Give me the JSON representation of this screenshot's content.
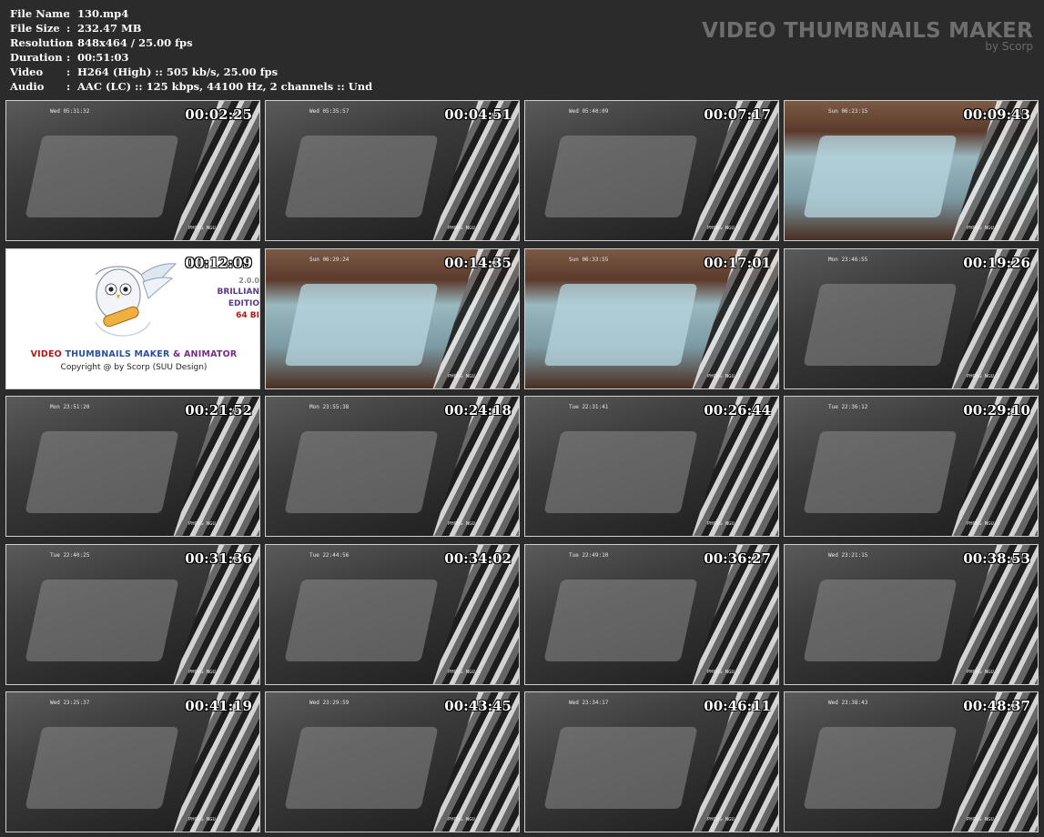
{
  "info": {
    "rows": [
      {
        "label": "File Name",
        "sep": ":",
        "value": "130.mp4"
      },
      {
        "label": "File Size",
        "sep": ":",
        "value": "232.47 MB"
      },
      {
        "label": "Resolution",
        "sep": ":",
        "value": "848x464 / 25.00 fps"
      },
      {
        "label": "Duration",
        "sep": ":",
        "value": "00:51:03"
      },
      {
        "label": "Video",
        "sep": ":",
        "value": "H264 (High) :: 505 kb/s, 25.00 fps"
      },
      {
        "label": "Audio",
        "sep": ":",
        "value": "AAC (LC) :: 125 kbps, 44100 Hz, 2 channels :: Und"
      }
    ]
  },
  "brand": {
    "title": "VIDEO THUMBNAILS MAKER",
    "by": "by Scorp"
  },
  "promo": {
    "title_part1": "VIDEO",
    "title_part2": " THUMBNAILS MAKER ",
    "title_part3": "& ANIMATOR",
    "copyright": "Copyright @ by Scorp (SUU Design)",
    "edition_0": "2.0.0",
    "edition_1": "BRILLIAN",
    "edition_2": "EDITIO",
    "edition_3": "64 BI"
  },
  "thumbs": [
    {
      "ts": "00:02:25",
      "date": "Wed 05:31:32",
      "cam": "PHONG NGU 1",
      "scene": "dark"
    },
    {
      "ts": "00:04:51",
      "date": "Wed 05:35:57",
      "cam": "PHONG NGU 1",
      "scene": "dark"
    },
    {
      "ts": "00:07:17",
      "date": "Wed 05:40:09",
      "cam": "PHONG NGU 1",
      "scene": "dark"
    },
    {
      "ts": "00:09:43",
      "date": "Sun 06:23:15",
      "cam": "PHONG NGU 1",
      "scene": "color"
    },
    {
      "ts": "00:12:09",
      "promo": true
    },
    {
      "ts": "00:14:35",
      "date": "Sun 06:29:24",
      "cam": "PHONG NGU 1",
      "scene": "color"
    },
    {
      "ts": "00:17:01",
      "date": "Sun 06:33:55",
      "cam": "PHONG NGU 1",
      "scene": "color"
    },
    {
      "ts": "00:19:26",
      "date": "Mon 23:46:55",
      "cam": "PHONG NGU 1",
      "scene": "dark"
    },
    {
      "ts": "00:21:52",
      "date": "Mon 23:51:20",
      "cam": "PHONG NGU 1",
      "scene": "dark"
    },
    {
      "ts": "00:24:18",
      "date": "Mon 23:55:38",
      "cam": "PHONG NGU 1",
      "scene": "dark"
    },
    {
      "ts": "00:26:44",
      "date": "Tue 22:31:41",
      "cam": "PHONG NGU 1",
      "scene": "dark"
    },
    {
      "ts": "00:29:10",
      "date": "Tue 22:36:12",
      "cam": "PHONG NGU 1",
      "scene": "dark"
    },
    {
      "ts": "00:31:36",
      "date": "Tue 22:40:25",
      "cam": "PHONG NGU 1",
      "scene": "dark"
    },
    {
      "ts": "00:34:02",
      "date": "Tue 22:44:56",
      "cam": "PHONG NGU 1",
      "scene": "dark"
    },
    {
      "ts": "00:36:27",
      "date": "Tue 22:49:10",
      "cam": "PHONG NGU 1",
      "scene": "dark"
    },
    {
      "ts": "00:38:53",
      "date": "Wed 23:21:15",
      "cam": "PHONG NGU 1",
      "scene": "dark"
    },
    {
      "ts": "00:41:19",
      "date": "Wed 23:25:37",
      "cam": "PHONG NGU 1",
      "scene": "dark"
    },
    {
      "ts": "00:43:45",
      "date": "Wed 23:29:59",
      "cam": "PHONG NGU 1",
      "scene": "dark"
    },
    {
      "ts": "00:46:11",
      "date": "Wed 23:34:17",
      "cam": "PHONG NGU 1",
      "scene": "dark"
    },
    {
      "ts": "00:48:37",
      "date": "Wed 23:38:43",
      "cam": "PHONG NGU 1",
      "scene": "dark"
    }
  ]
}
